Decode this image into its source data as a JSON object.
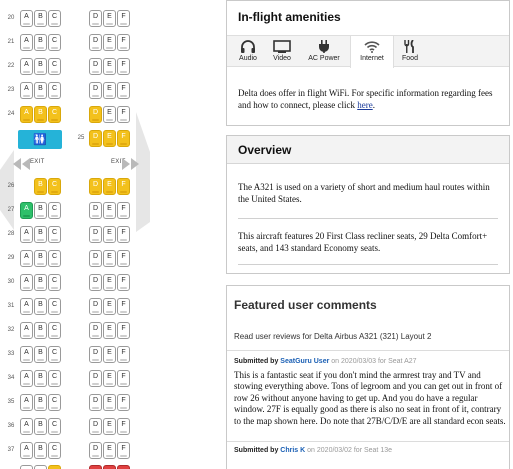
{
  "seatmap": {
    "rows": [
      {
        "num": "20",
        "seats": [
          "A",
          "B",
          "C",
          "D",
          "E",
          "F"
        ],
        "colors": [
          "w",
          "w",
          "w",
          "w",
          "w",
          "w"
        ]
      },
      {
        "num": "21",
        "seats": [
          "A",
          "B",
          "C",
          "D",
          "E",
          "F"
        ],
        "colors": [
          "w",
          "w",
          "w",
          "w",
          "w",
          "w"
        ]
      },
      {
        "num": "22",
        "seats": [
          "A",
          "B",
          "C",
          "D",
          "E",
          "F"
        ],
        "colors": [
          "w",
          "w",
          "w",
          "w",
          "w",
          "w"
        ]
      },
      {
        "num": "23",
        "seats": [
          "A",
          "B",
          "C",
          "D",
          "E",
          "F"
        ],
        "colors": [
          "w",
          "w",
          "w",
          "w",
          "w",
          "w"
        ]
      },
      {
        "num": "24",
        "seats": [
          "A",
          "B",
          "C",
          "D",
          "E",
          "F"
        ],
        "colors": [
          "y",
          "y",
          "y",
          "y",
          "w",
          "w"
        ]
      }
    ],
    "row25": {
      "num": "25",
      "seats": [
        "D",
        "E",
        "F"
      ]
    },
    "exit_label": "EXIT",
    "rows2": [
      {
        "num": "26",
        "seats": [
          "",
          "B",
          "C",
          "D",
          "E",
          "F"
        ],
        "colors": [
          "n",
          "y",
          "y",
          "y",
          "y",
          "y"
        ]
      },
      {
        "num": "27",
        "seats": [
          "A",
          "B",
          "C",
          "D",
          "E",
          "F"
        ],
        "colors": [
          "g",
          "w",
          "w",
          "w",
          "w",
          "w"
        ]
      },
      {
        "num": "28",
        "seats": [
          "A",
          "B",
          "C",
          "D",
          "E",
          "F"
        ],
        "colors": [
          "w",
          "w",
          "w",
          "w",
          "w",
          "w"
        ]
      },
      {
        "num": "29",
        "seats": [
          "A",
          "B",
          "C",
          "D",
          "E",
          "F"
        ],
        "colors": [
          "w",
          "w",
          "w",
          "w",
          "w",
          "w"
        ]
      },
      {
        "num": "30",
        "seats": [
          "A",
          "B",
          "C",
          "D",
          "E",
          "F"
        ],
        "colors": [
          "w",
          "w",
          "w",
          "w",
          "w",
          "w"
        ]
      },
      {
        "num": "31",
        "seats": [
          "A",
          "B",
          "C",
          "D",
          "E",
          "F"
        ],
        "colors": [
          "w",
          "w",
          "w",
          "w",
          "w",
          "w"
        ]
      },
      {
        "num": "32",
        "seats": [
          "A",
          "B",
          "C",
          "D",
          "E",
          "F"
        ],
        "colors": [
          "w",
          "w",
          "w",
          "w",
          "w",
          "w"
        ]
      },
      {
        "num": "33",
        "seats": [
          "A",
          "B",
          "C",
          "D",
          "E",
          "F"
        ],
        "colors": [
          "w",
          "w",
          "w",
          "w",
          "w",
          "w"
        ]
      },
      {
        "num": "34",
        "seats": [
          "A",
          "B",
          "C",
          "D",
          "E",
          "F"
        ],
        "colors": [
          "w",
          "w",
          "w",
          "w",
          "w",
          "w"
        ]
      },
      {
        "num": "35",
        "seats": [
          "A",
          "B",
          "C",
          "D",
          "E",
          "F"
        ],
        "colors": [
          "w",
          "w",
          "w",
          "w",
          "w",
          "w"
        ]
      },
      {
        "num": "36",
        "seats": [
          "A",
          "B",
          "C",
          "D",
          "E",
          "F"
        ],
        "colors": [
          "w",
          "w",
          "w",
          "w",
          "w",
          "w"
        ]
      },
      {
        "num": "37",
        "seats": [
          "A",
          "B",
          "C",
          "D",
          "E",
          "F"
        ],
        "colors": [
          "w",
          "w",
          "w",
          "w",
          "w",
          "w"
        ]
      }
    ],
    "colors": {
      "yellow": "#f3c11c",
      "green": "#2ec06a",
      "lavatory": "#25b3d8"
    }
  },
  "amenities": {
    "title": "In-flight amenities",
    "tabs": [
      {
        "label": "Audio",
        "icon": "headphones-icon"
      },
      {
        "label": "Video",
        "icon": "monitor-icon"
      },
      {
        "label": "AC Power",
        "icon": "plug-icon"
      },
      {
        "label": "Internet",
        "icon": "wifi-icon"
      },
      {
        "label": "Food",
        "icon": "utensils-icon"
      }
    ],
    "active_tab": "Internet",
    "text": "Delta does offer in flight WiFi. For specific information regarding fees and how to connect, please click",
    "link": "here",
    "text_end": "."
  },
  "overview": {
    "title": "Overview",
    "p1": "The A321 is used on a variety of short and medium haul routes within the United States.",
    "p2": "This aircraft features 20 First Class recliner seats, 29 Delta Comfort+ seats, and 143 standard Economy seats."
  },
  "comments": {
    "title": "Featured user comments",
    "subtitle": "Read user reviews for Delta Airbus A321 (321) Layout 2",
    "items": [
      {
        "submitted_by": "Submitted by",
        "user": "SeatGuru User",
        "meta": "on 2020/03/03 for Seat A27",
        "text": "This is a fantastic seat if you don't mind the armrest tray and TV and stowing everything above. Tons of legroom and you can get out in front of row 26 without anyone having to get up. And you do have a regular window. 27F is equally good as there is also no seat in front of it, contrary to the map shown here. Do note that 27B/C/D/E are all standard econ seats."
      },
      {
        "submitted_by": "Submitted by",
        "user": "Chris K",
        "meta": "on 2020/03/02 for Seat 13e"
      }
    ]
  }
}
